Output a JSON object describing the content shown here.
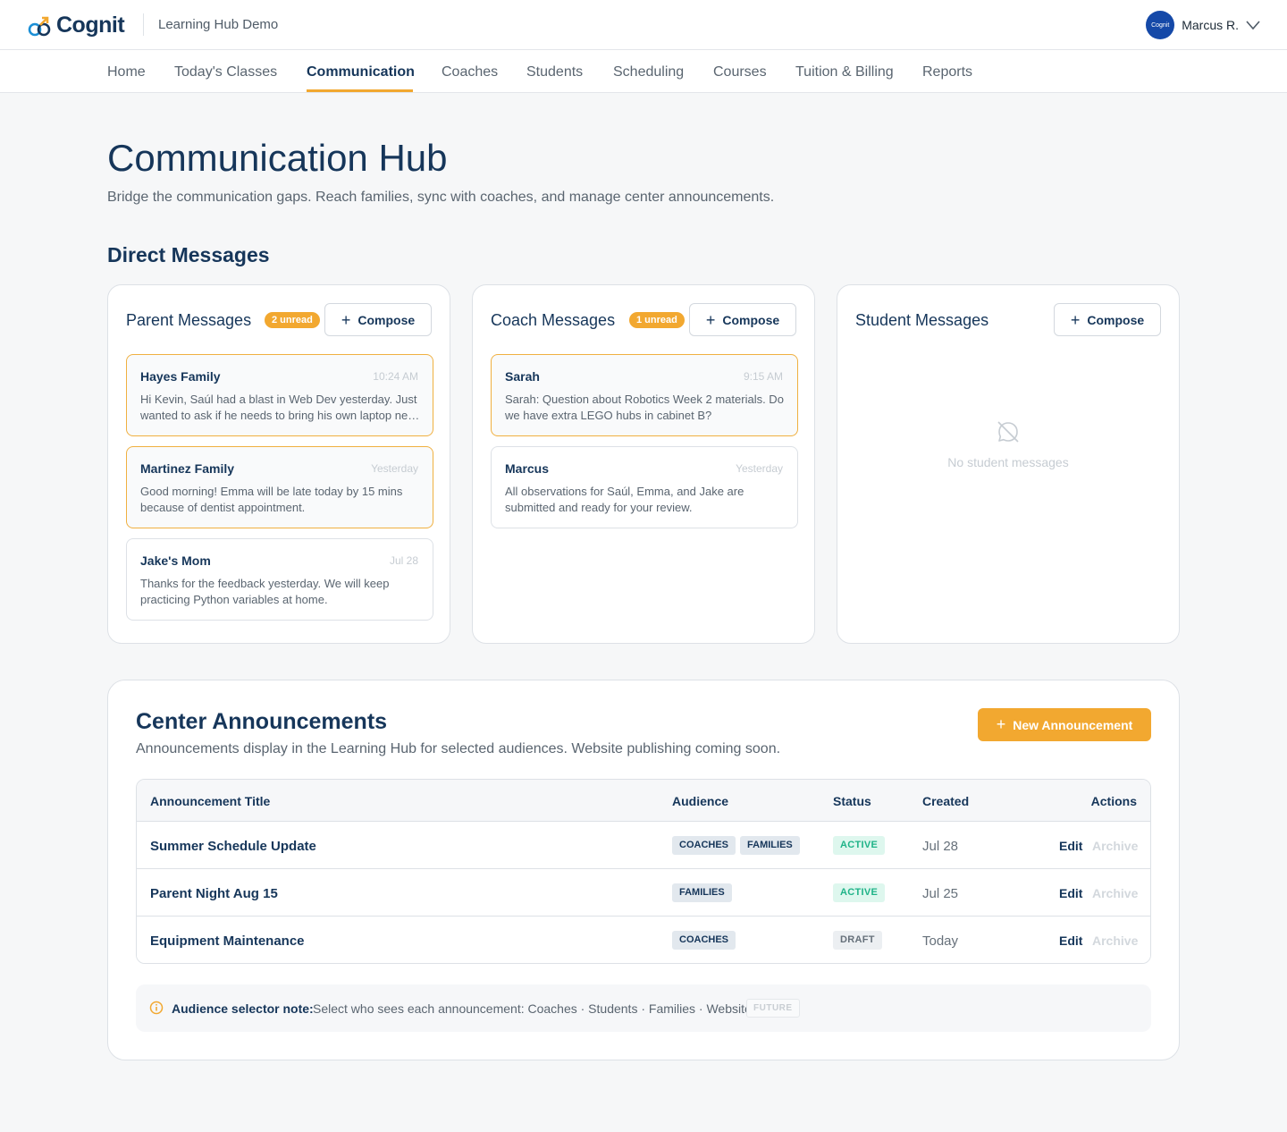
{
  "header": {
    "logo_text": "Cognit",
    "hub_name": "Learning Hub Demo",
    "avatar_text": "Cognit",
    "user_name": "Marcus R."
  },
  "nav": {
    "items": [
      "Home",
      "Today's Classes",
      "Communication",
      "Coaches",
      "Students",
      "Scheduling",
      "Courses",
      "Tuition & Billing",
      "Reports"
    ],
    "active": "Communication"
  },
  "page": {
    "title": "Communication Hub",
    "subtitle": "Bridge the communication gaps. Reach families, sync with coaches, and manage center announcements.",
    "direct_messages_title": "Direct Messages"
  },
  "compose_label": "Compose",
  "parent": {
    "title": "Parent Messages",
    "unread": "2 unread",
    "messages": [
      {
        "from": "Hayes Family",
        "time": "10:24 AM",
        "body": "Hi Kevin, Saúl had a blast in Web Dev yesterday. Just wanted to ask if he needs to bring his own laptop next time or if the center provides one.",
        "unread": true
      },
      {
        "from": "Martinez Family",
        "time": "Yesterday",
        "body": "Good morning! Emma will be late today by 15 mins because of dentist appointment.",
        "unread": true
      },
      {
        "from": "Jake's Mom",
        "time": "Jul 28",
        "body": "Thanks for the feedback yesterday. We will keep practicing Python variables at home.",
        "unread": false
      }
    ]
  },
  "coach": {
    "title": "Coach Messages",
    "unread": "1 unread",
    "messages": [
      {
        "from": "Sarah",
        "time": "9:15 AM",
        "body": "Sarah: Question about Robotics Week 2 materials. Do we have extra LEGO hubs in cabinet B?",
        "unread": true
      },
      {
        "from": "Marcus",
        "time": "Yesterday",
        "body": "All observations for Saúl, Emma, and Jake are submitted and ready for your review.",
        "unread": false
      }
    ]
  },
  "student": {
    "title": "Student Messages",
    "empty_text": "No student messages"
  },
  "announcements": {
    "title": "Center Announcements",
    "subtitle": "Announcements display in the Learning Hub for selected audiences. Website publishing coming soon.",
    "new_button": "New Announcement",
    "columns": {
      "title": "Announcement Title",
      "audience": "Audience",
      "status": "Status",
      "created": "Created",
      "actions": "Actions"
    },
    "rows": [
      {
        "title": "Summer Schedule Update",
        "audience": [
          "COACHES",
          "FAMILIES"
        ],
        "status": "ACTIVE",
        "created": "Jul 28",
        "edit": "Edit",
        "archive": "Archive"
      },
      {
        "title": "Parent Night Aug 15",
        "audience": [
          "FAMILIES"
        ],
        "status": "ACTIVE",
        "created": "Jul 25",
        "edit": "Edit",
        "archive": "Archive"
      },
      {
        "title": "Equipment Maintenance",
        "audience": [
          "COACHES"
        ],
        "status": "DRAFT",
        "created": "Today",
        "edit": "Edit",
        "archive": "Archive"
      }
    ],
    "note_label": "Audience selector note:",
    "note_text": "Select who sees each announcement: Coaches · Students · Families · Website",
    "note_tag": "FUTURE"
  },
  "colors": {
    "accent": "#f2a830",
    "navy": "#16365a",
    "active_status": "#1fb388"
  }
}
